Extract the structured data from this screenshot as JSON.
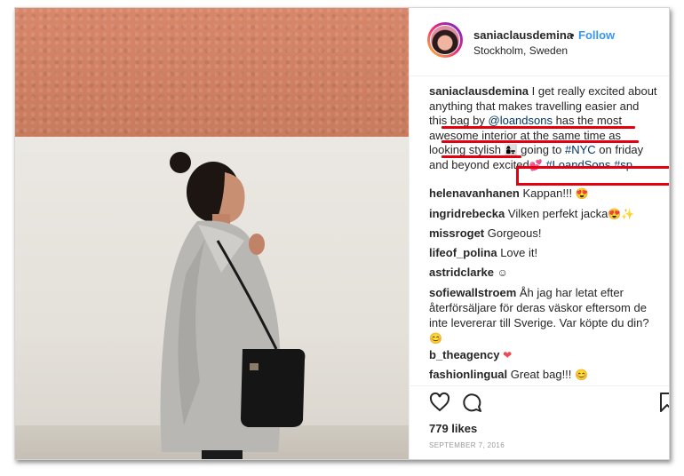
{
  "post": {
    "username": "saniaclausdemina",
    "separator": "•",
    "follow_label": "Follow",
    "location": "Stockholm, Sweden"
  },
  "caption": {
    "username": "saniaclausdemina",
    "line1": " I get really excited about",
    "line2": "anything that makes travelling easier and",
    "line3a": "this bag by ",
    "mention": "@loandsons",
    "line3b": " has the most",
    "line4": "awesome interior at the same time as",
    "line5a": "looking stylish ",
    "line5b": " going to ",
    "hashtag_nyc": "#NYC",
    "line5c": " on friday",
    "line6a": "and beyond excited",
    "hashtag_loandsons": "#LoandSons",
    "hashtag_sp": "#sp"
  },
  "comments": [
    {
      "user": "helenavanhanen",
      "text": "Kappan!!!",
      "emoji": "😍"
    },
    {
      "user": "ingridrebecka",
      "text": "Vilken perfekt jacka",
      "emoji": "😍✨"
    },
    {
      "user": "missroget",
      "text": "Gorgeous!",
      "emoji": ""
    },
    {
      "user": "lifeof_polina",
      "text": "Love it!",
      "emoji": ""
    },
    {
      "user": "astridclarke",
      "text": "",
      "emoji": "☺"
    },
    {
      "user": "sofiewallstroem",
      "text": "Åh jag har letat efter återförsäljare för deras väskor eftersom de inte levererar till Sverige. Var köpte du din?",
      "emoji": "😊"
    },
    {
      "user": "b_theagency",
      "text": "",
      "emoji": "❤"
    },
    {
      "user": "fashionlingual",
      "text": "Great bag!!!",
      "emoji": "😊"
    }
  ],
  "icons": {
    "like": "heart-icon",
    "comment": "comment-bubble-icon",
    "save": "bookmark-icon"
  },
  "likes_label": "779 likes",
  "date_label": "SEPTEMBER 7, 2016",
  "colors": {
    "follow": "#3897f0",
    "link": "#003569",
    "annotation": "#e4000f",
    "wall_top": "#d8876a"
  }
}
